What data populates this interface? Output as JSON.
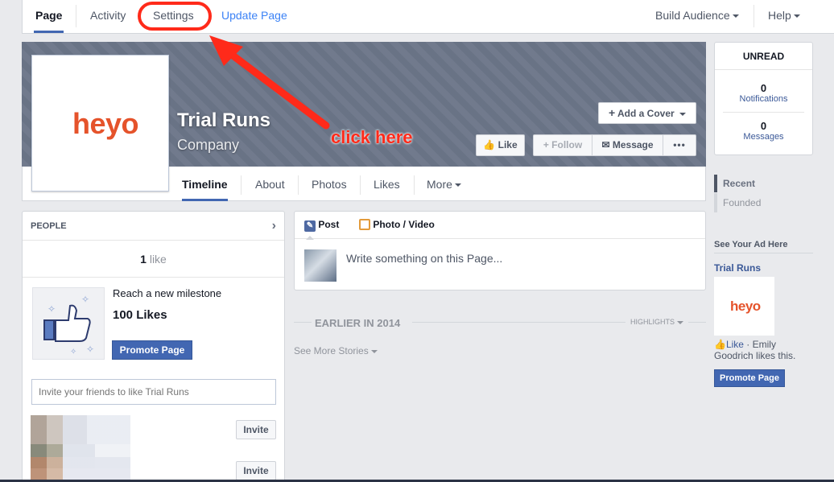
{
  "topbar": {
    "tabs": [
      "Page",
      "Activity",
      "Settings",
      "Update Page"
    ],
    "build_audience": "Build Audience",
    "help": "Help"
  },
  "annotation": {
    "label": "click here",
    "color": "#ff2a1a"
  },
  "cover": {
    "page_name": "Trial Runs",
    "category": "Company",
    "logo_text": "heyo",
    "add_cover": "Add a Cover",
    "like": "Like",
    "follow": "Follow",
    "message": "Message",
    "more_dots": "•••"
  },
  "page_nav": [
    "Timeline",
    "About",
    "Photos",
    "Likes",
    "More"
  ],
  "unread": {
    "title": "UNREAD",
    "notifications_count": "0",
    "notifications_label": "Notifications",
    "messages_count": "0",
    "messages_label": "Messages"
  },
  "timeline_nav": {
    "recent": "Recent",
    "founded": "Founded"
  },
  "ad": {
    "header": "See Your Ad Here",
    "page": "Trial Runs",
    "logo_text": "heyo",
    "like": "Like",
    "social": " · Emily Goodrich likes this.",
    "promote": "Promote Page"
  },
  "people": {
    "title": "PEOPLE",
    "likes_count": "1",
    "likes_label": "like",
    "milestone_text": "Reach a new milestone",
    "milestone_value": "100 Likes",
    "promote": "Promote Page",
    "invite_placeholder": "Invite your friends to like Trial Runs",
    "invite_btn": "Invite"
  },
  "composer": {
    "post": "Post",
    "photo_video": "Photo / Video",
    "placeholder": "Write something on this Page..."
  },
  "feed": {
    "earlier": "EARLIER IN 2014",
    "highlights": "HIGHLIGHTS",
    "see_more": "See More Stories"
  },
  "colors": {
    "accent": "#4267b2",
    "brand": "#e5532b",
    "cover": "#6b7588"
  }
}
